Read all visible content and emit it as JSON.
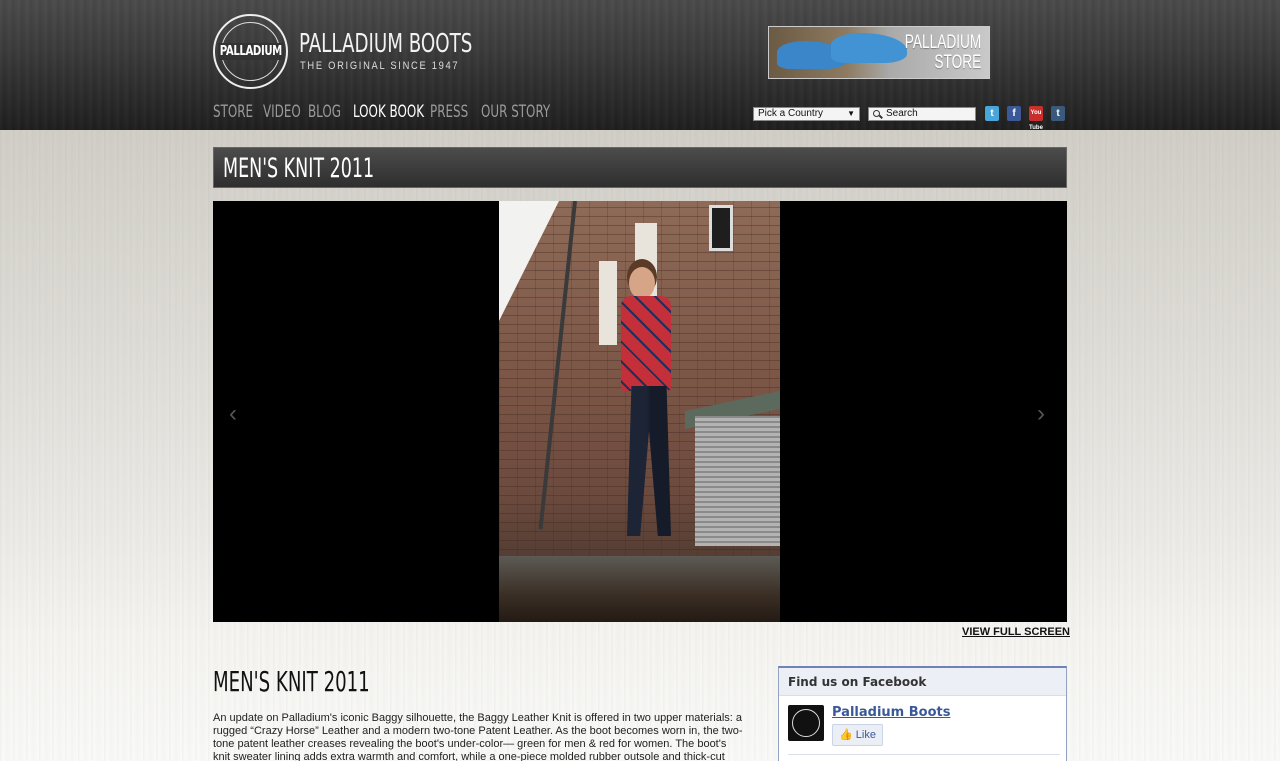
{
  "brand": {
    "seal_word": "PALLADIUM",
    "title": "PALLADIUM BOOTS",
    "tagline": "THE ORIGINAL SINCE 1947"
  },
  "store_banner": {
    "line1": "PALLADIUM",
    "line2": "STORE"
  },
  "nav": [
    {
      "label": "STORE",
      "active": false
    },
    {
      "label": "VIDEO",
      "active": false
    },
    {
      "label": "BLOG",
      "active": false
    },
    {
      "label": "LOOK BOOK",
      "active": true
    },
    {
      "label": "PRESS",
      "active": false
    },
    {
      "label": "OUR STORY",
      "active": false
    }
  ],
  "country_select": {
    "value": "Pick a Country"
  },
  "search": {
    "placeholder": "Search"
  },
  "social": {
    "twitter": "t",
    "facebook": "f",
    "youtube": "You Tube",
    "tumblr": "t"
  },
  "gallery": {
    "title": "MEN'S KNIT 2011",
    "view_full_screen": "VIEW FULL SCREEN"
  },
  "content": {
    "title": "MEN'S KNIT 2011",
    "body": "An update on Palladium's iconic Baggy silhouette, the Baggy Leather Knit is offered in two upper materials: a rugged “Crazy Horse” Leather and a modern two-tone Patent Leather. As the boot becomes worn in, the two-tone patent leather creases revealing the boot's under-color— green for men & red for women. The boot's knit sweater lining adds extra warmth and comfort, while a one-piece molded rubber outsole and thick-cut EVA"
  },
  "facebook": {
    "header": "Find us on Facebook",
    "page_name": "Palladium Boots",
    "like_label": "Like"
  },
  "colors": {
    "header_bg": "#2c2c2c",
    "nav_inactive": "#9a9a9a",
    "nav_active": "#ffffff",
    "facebook_blue": "#3b5998"
  }
}
